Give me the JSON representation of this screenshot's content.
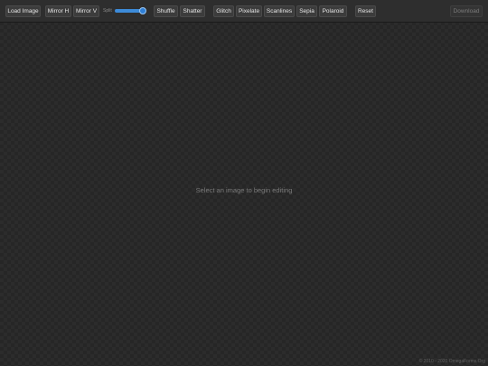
{
  "toolbar": {
    "load_image": "Load Image",
    "mirror_h": "Mirror H",
    "mirror_v": "Mirror V",
    "split_label": "Split",
    "split_value": 1.0,
    "shuffle": "Shuffle",
    "shatter": "Shatter",
    "glitch": "Glitch",
    "pixelate": "Pixelate",
    "scanlines": "Scanlines",
    "sepia": "Sepia",
    "polaroid": "Polaroid",
    "reset": "Reset",
    "download": "Download"
  },
  "canvas": {
    "empty_message": "Select an image to begin editing"
  },
  "footer": {
    "copyright": "© 2010 - 2020 OmegaForms.Org"
  },
  "colors": {
    "slider_accent": "#3d8bd9"
  }
}
